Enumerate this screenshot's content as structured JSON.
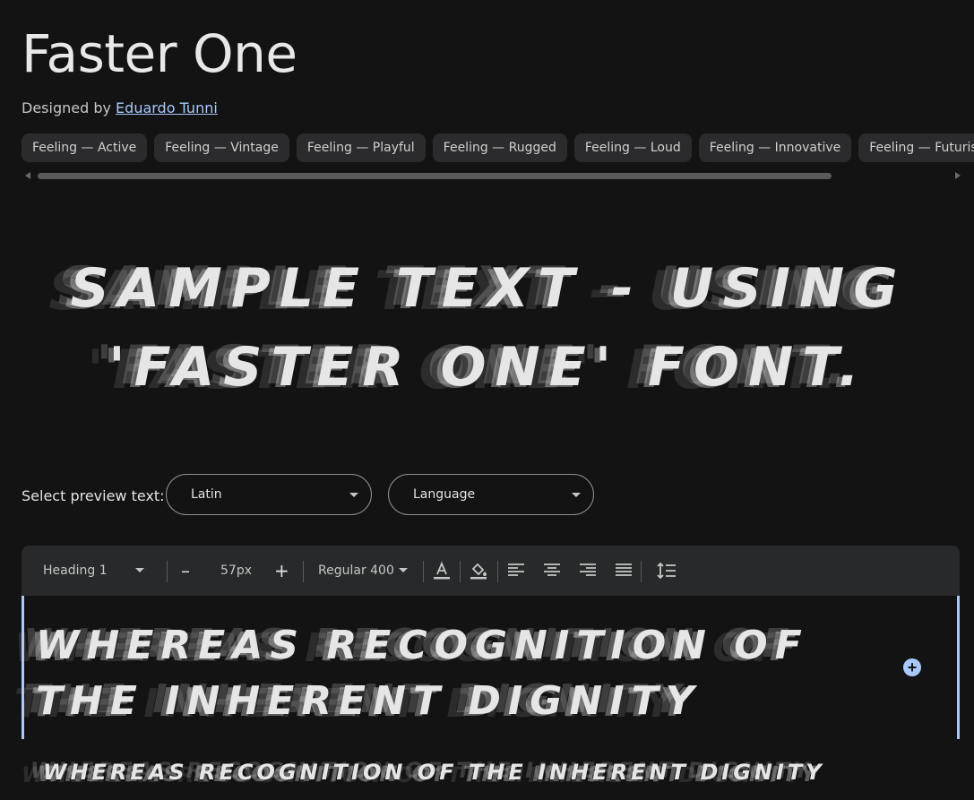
{
  "font": {
    "name": "Faster One",
    "designed_by_label": "Designed by",
    "designer": "Eduardo Tunni"
  },
  "tags": [
    "Feeling — Active",
    "Feeling — Vintage",
    "Feeling — Playful",
    "Feeling — Rugged",
    "Feeling — Loud",
    "Feeling — Innovative",
    "Feeling — Futuristic"
  ],
  "sample_text": {
    "line1": "Sample Text - Using",
    "line2": "'Faster One' Font."
  },
  "preview": {
    "label": "Select preview text:",
    "script_value": "Latin",
    "language_placeholder": "Language"
  },
  "toolbar": {
    "style_value": "Heading 1",
    "size_value": "57px",
    "weight_value": "Regular 400",
    "decrease_label": "–",
    "increase_label": "+"
  },
  "editor": {
    "heading_text": "Whereas recognition of the inherent dignity",
    "paragraph_text": "Whereas recognition of the inherent dignity",
    "add_label": "+"
  },
  "colors": {
    "background": "#131314",
    "toolbar_bg": "#28292a",
    "accent": "#a8c7fa",
    "chip_bg": "#2b2b2d"
  }
}
